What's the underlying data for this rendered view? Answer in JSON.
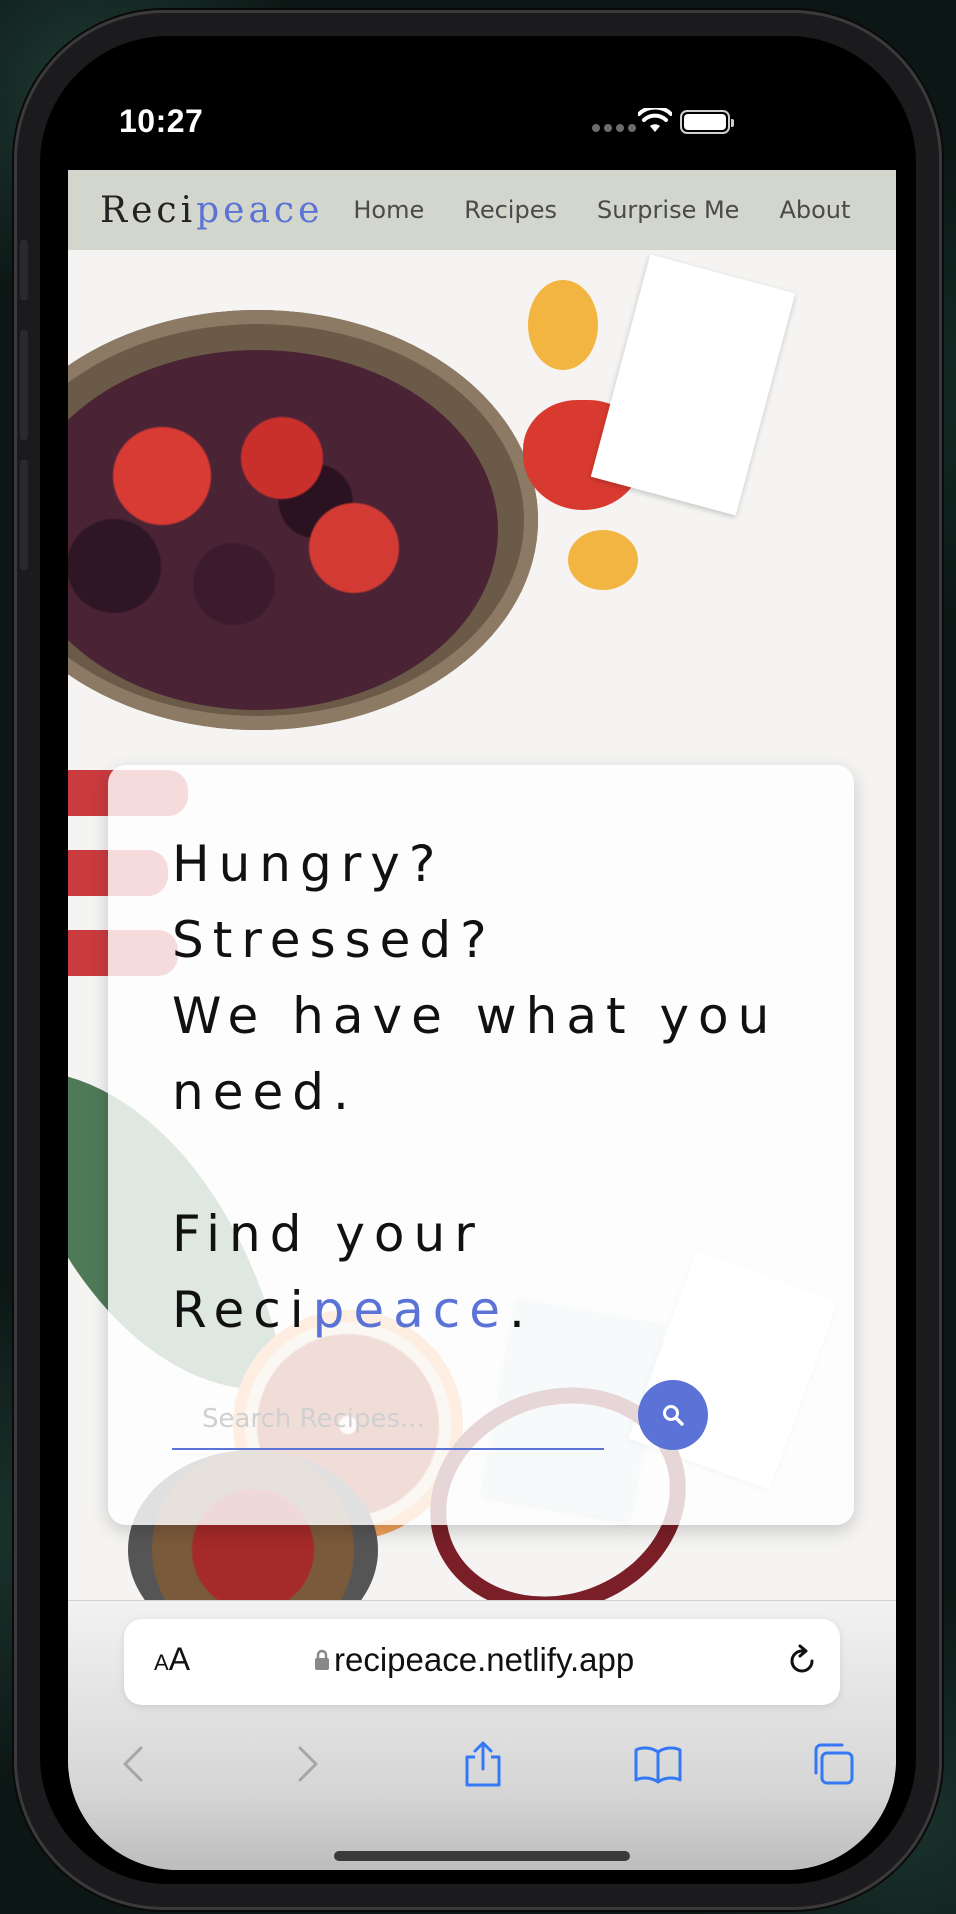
{
  "status": {
    "time": "10:27"
  },
  "nav": {
    "logo_part1": "Reci",
    "logo_part2": "peace",
    "links": [
      "Home",
      "Recipes",
      "Surprise Me",
      "About"
    ]
  },
  "hero": {
    "line1": "Hungry?",
    "line2": "Stressed?",
    "line3": "We have what you",
    "line4": "need.",
    "line5": "Find your",
    "line6_part1": "Reci",
    "line6_part2": "peace",
    "line6_part3": "."
  },
  "search": {
    "placeholder": "Search Recipes...",
    "value": ""
  },
  "browser": {
    "text_size_small": "A",
    "text_size_large": "A",
    "url": "recipeace.netlify.app"
  },
  "colors": {
    "accent": "#5b72d6",
    "nav_bg": "#d2d6cc"
  }
}
